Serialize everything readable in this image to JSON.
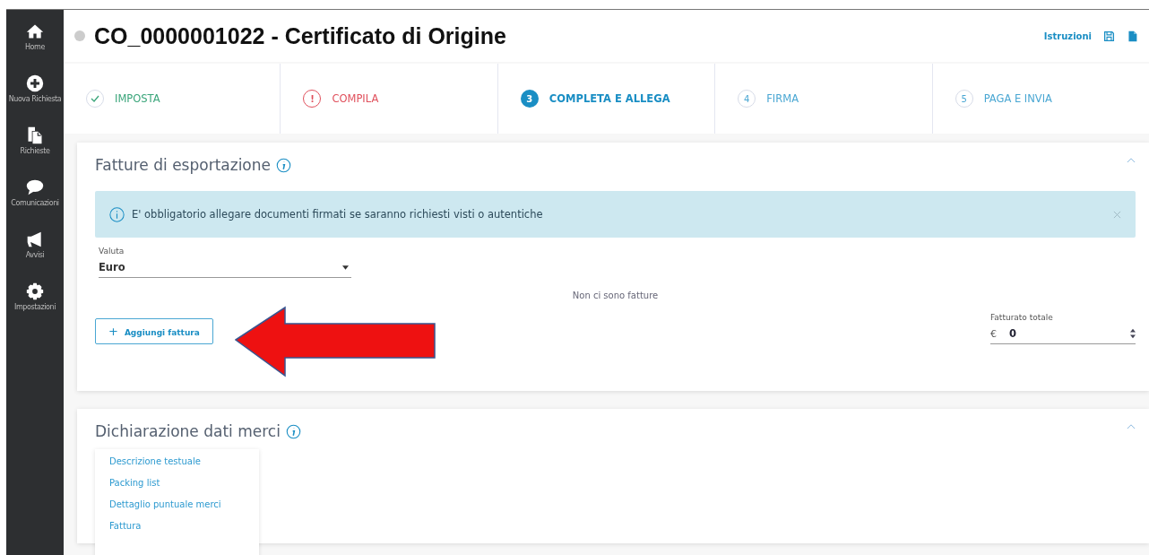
{
  "sidebar": {
    "items": [
      {
        "label": "Home"
      },
      {
        "label": "Nuova Richiesta"
      },
      {
        "label": "Richieste"
      },
      {
        "label": "Comunicazioni"
      },
      {
        "label": "Avvisi"
      },
      {
        "label": "Impostazioni"
      }
    ]
  },
  "header": {
    "title": "CO_0000001022 - Certificato di Origine",
    "instructions_link": "Istruzioni"
  },
  "steps": [
    {
      "label": "IMPOSTA",
      "kind": "done"
    },
    {
      "marker": "!",
      "label": "COMPILA",
      "kind": "error"
    },
    {
      "marker": "3",
      "label": "COMPLETA E ALLEGA",
      "kind": "current"
    },
    {
      "marker": "4",
      "label": "FIRMA",
      "kind": "todo"
    },
    {
      "marker": "5",
      "label": "PAGA E INVIA",
      "kind": "todo"
    }
  ],
  "invoices_section": {
    "title": "Fatture di esportazione",
    "expanded": true,
    "alert": "E' obbligatorio allegare documenti firmati se saranno richiesti visti o autentiche",
    "currency": {
      "label": "Valuta",
      "value": "Euro"
    },
    "empty_message": "Non ci sono fatture",
    "add_button": "Aggiungi fattura",
    "add_button_icon": "+",
    "total": {
      "label": "Fatturato totale",
      "currency_symbol": "€",
      "value": "0"
    }
  },
  "goods_section": {
    "title": "Dichiarazione dati merci",
    "expanded": true,
    "menu": [
      "Descrizione testuale",
      "Packing list",
      "Dettaglio puntuale merci",
      "Fattura"
    ]
  }
}
